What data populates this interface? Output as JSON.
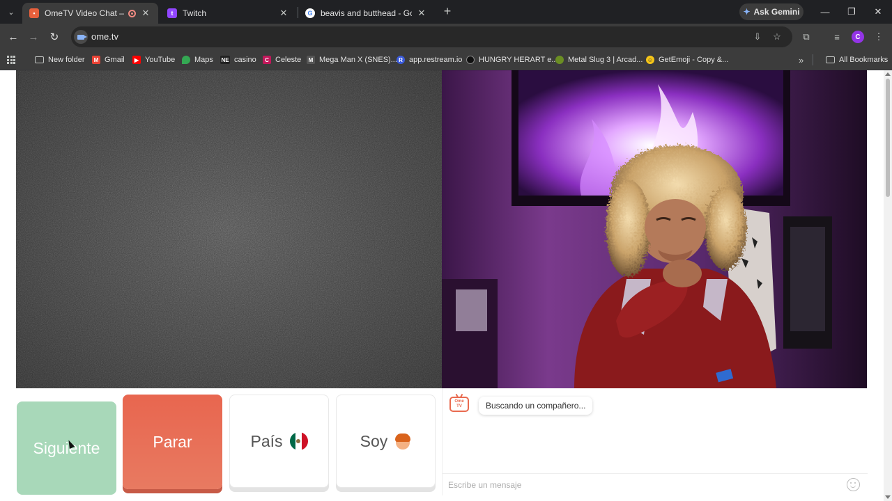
{
  "browser": {
    "tabs": [
      {
        "title": "OmeTV Video Chat — Ome",
        "active": true,
        "favicon_color": "#e8603c",
        "recording": true
      },
      {
        "title": "Twitch",
        "active": false,
        "favicon_color": "#9146ff"
      },
      {
        "title": "beavis and butthead - Google S",
        "active": false,
        "favicon_color": "#4285f4"
      }
    ],
    "gemini_label": "Ask Gemini",
    "url": "ome.tv",
    "profile_initial": "C",
    "bookmarks": [
      {
        "label": "New folder",
        "icon": "folder-icon"
      },
      {
        "label": "Gmail",
        "icon": "gmail-icon",
        "color": "#ea4335",
        "glyph": "M"
      },
      {
        "label": "YouTube",
        "icon": "youtube-icon",
        "color": "#ff0000",
        "glyph": "▶"
      },
      {
        "label": "Maps",
        "icon": "maps-icon",
        "color": "#34a853",
        "glyph": "●"
      },
      {
        "label": "casino",
        "icon": "casino-icon",
        "color": "#222222",
        "glyph": "NE"
      },
      {
        "label": "Celeste",
        "icon": "celeste-icon",
        "color": "#c2185b",
        "glyph": "C"
      },
      {
        "label": "Mega Man X (SNES)...",
        "icon": "megaman-icon",
        "color": "#555555",
        "glyph": "M"
      },
      {
        "label": "app.restream.io",
        "icon": "restream-icon",
        "color": "#3b5bdb",
        "glyph": "R"
      },
      {
        "label": "HUNGRY HERART e...",
        "icon": "hungry-icon",
        "color": "#111111",
        "glyph": "H"
      },
      {
        "label": "Metal Slug 3 | Arcad...",
        "icon": "metalslug-icon",
        "color": "#6b8e23",
        "glyph": "•"
      },
      {
        "label": "GetEmoji - Copy &...",
        "icon": "getemoji-icon",
        "color": "#f5c518",
        "glyph": "☺"
      }
    ],
    "all_bookmarks_label": "All Bookmarks"
  },
  "ometv": {
    "next_label": "Siguiente",
    "stop_label": "Parar",
    "country_label": "País",
    "country_flag": "mexico-flag-icon",
    "gender_label": "Soy",
    "gender_icon": "boy-emoji-icon",
    "status_message": "Buscando un compañero...",
    "chat_placeholder": "Escribe un mensaje",
    "colors": {
      "next_bg": "#a8d8b9",
      "stop_bg": "#e8664f",
      "brand": "#e96a4f"
    }
  }
}
